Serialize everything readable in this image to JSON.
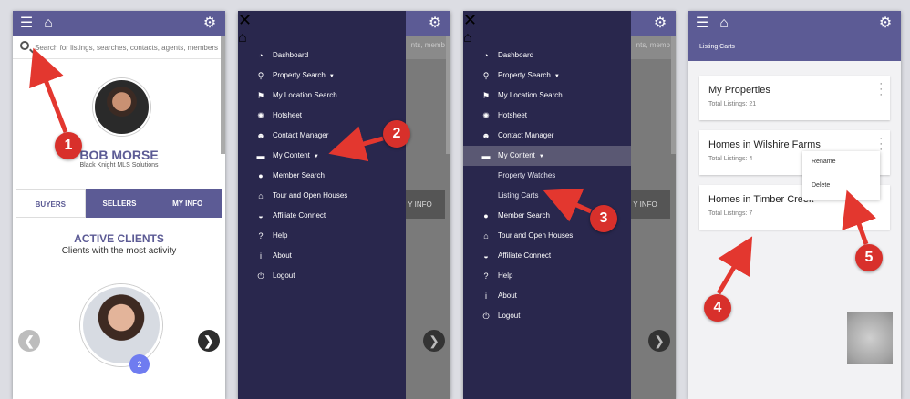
{
  "colors": {
    "brand": "#5c5b95",
    "drawer": "#29274d",
    "callout": "#d8302b"
  },
  "icons": {
    "menu": "hamburger-icon",
    "home": "home-icon",
    "settings": "gear-icon",
    "close": "close-icon",
    "search": "search-icon"
  },
  "screen1": {
    "search_placeholder": "Search for listings, searches, contacts, agents, members",
    "agent_name": "BOB MORSE",
    "agent_org": "Black Knight MLS Solutions",
    "tabs": [
      "BUYERS",
      "SELLERS",
      "MY INFO"
    ],
    "active_title": "ACTIVE CLIENTS",
    "active_subtitle": "Clients with the most activity",
    "client_badge": "2",
    "prev_glyph": "❮",
    "next_glyph": "❯"
  },
  "screen2": {
    "menu": [
      {
        "icon": "dashboard-icon",
        "glyph": "◔",
        "label": "Dashboard"
      },
      {
        "icon": "search-icon",
        "glyph": "⚲",
        "label": "Property Search",
        "caret": "▼"
      },
      {
        "icon": "location-pin-icon",
        "glyph": "⚑",
        "label": "My Location Search"
      },
      {
        "icon": "hotsheet-icon",
        "glyph": "✺",
        "label": "Hotsheet"
      },
      {
        "icon": "contacts-icon",
        "glyph": "☻",
        "label": "Contact Manager"
      },
      {
        "icon": "folder-icon",
        "glyph": "▬",
        "label": "My Content",
        "caret": "▼"
      },
      {
        "icon": "member-icon",
        "glyph": "●",
        "label": "Member Search"
      },
      {
        "icon": "house-icon",
        "glyph": "⌂",
        "label": "Tour and Open Houses"
      },
      {
        "icon": "affiliate-icon",
        "glyph": "◒",
        "label": "Affiliate Connect"
      },
      {
        "icon": "help-icon",
        "glyph": "?",
        "label": "Help"
      },
      {
        "icon": "info-icon",
        "glyph": "i",
        "label": "About"
      },
      {
        "icon": "power-icon",
        "glyph": "⏻",
        "label": "Logout"
      }
    ],
    "ghost_search": "nts, memb",
    "ghost_tab": "Y INFO"
  },
  "screen3": {
    "menu": [
      {
        "icon": "dashboard-icon",
        "glyph": "◔",
        "label": "Dashboard"
      },
      {
        "icon": "search-icon",
        "glyph": "⚲",
        "label": "Property Search",
        "caret": "▼"
      },
      {
        "icon": "location-pin-icon",
        "glyph": "⚑",
        "label": "My Location Search"
      },
      {
        "icon": "hotsheet-icon",
        "glyph": "✺",
        "label": "Hotsheet"
      },
      {
        "icon": "contacts-icon",
        "glyph": "☻",
        "label": "Contact Manager"
      },
      {
        "icon": "folder-icon",
        "glyph": "▬",
        "label": "My Content",
        "caret": "▼",
        "selected": true
      }
    ],
    "submenu": [
      "Property Watches",
      "Listing Carts"
    ],
    "menu_rest": [
      {
        "icon": "member-icon",
        "glyph": "●",
        "label": "Member Search"
      },
      {
        "icon": "house-icon",
        "glyph": "⌂",
        "label": "Tour and Open Houses"
      },
      {
        "icon": "affiliate-icon",
        "glyph": "◒",
        "label": "Affiliate Connect"
      },
      {
        "icon": "help-icon",
        "glyph": "?",
        "label": "Help"
      },
      {
        "icon": "info-icon",
        "glyph": "i",
        "label": "About"
      },
      {
        "icon": "power-icon",
        "glyph": "⏻",
        "label": "Logout"
      }
    ],
    "ghost_search": "nts, memb",
    "ghost_tab": "Y INFO"
  },
  "screen4": {
    "header": "Listing Carts",
    "carts": [
      {
        "title": "My Properties",
        "count": "Total Listings: 21"
      },
      {
        "title": "Homes in Wilshire Farms",
        "count": "Total Listings: 4"
      },
      {
        "title": "Homes in Timber Creek",
        "count": "Total Listings: 7"
      }
    ],
    "context_menu": [
      "Rename",
      "Delete"
    ]
  },
  "callouts": [
    "1",
    "2",
    "3",
    "4",
    "5"
  ]
}
